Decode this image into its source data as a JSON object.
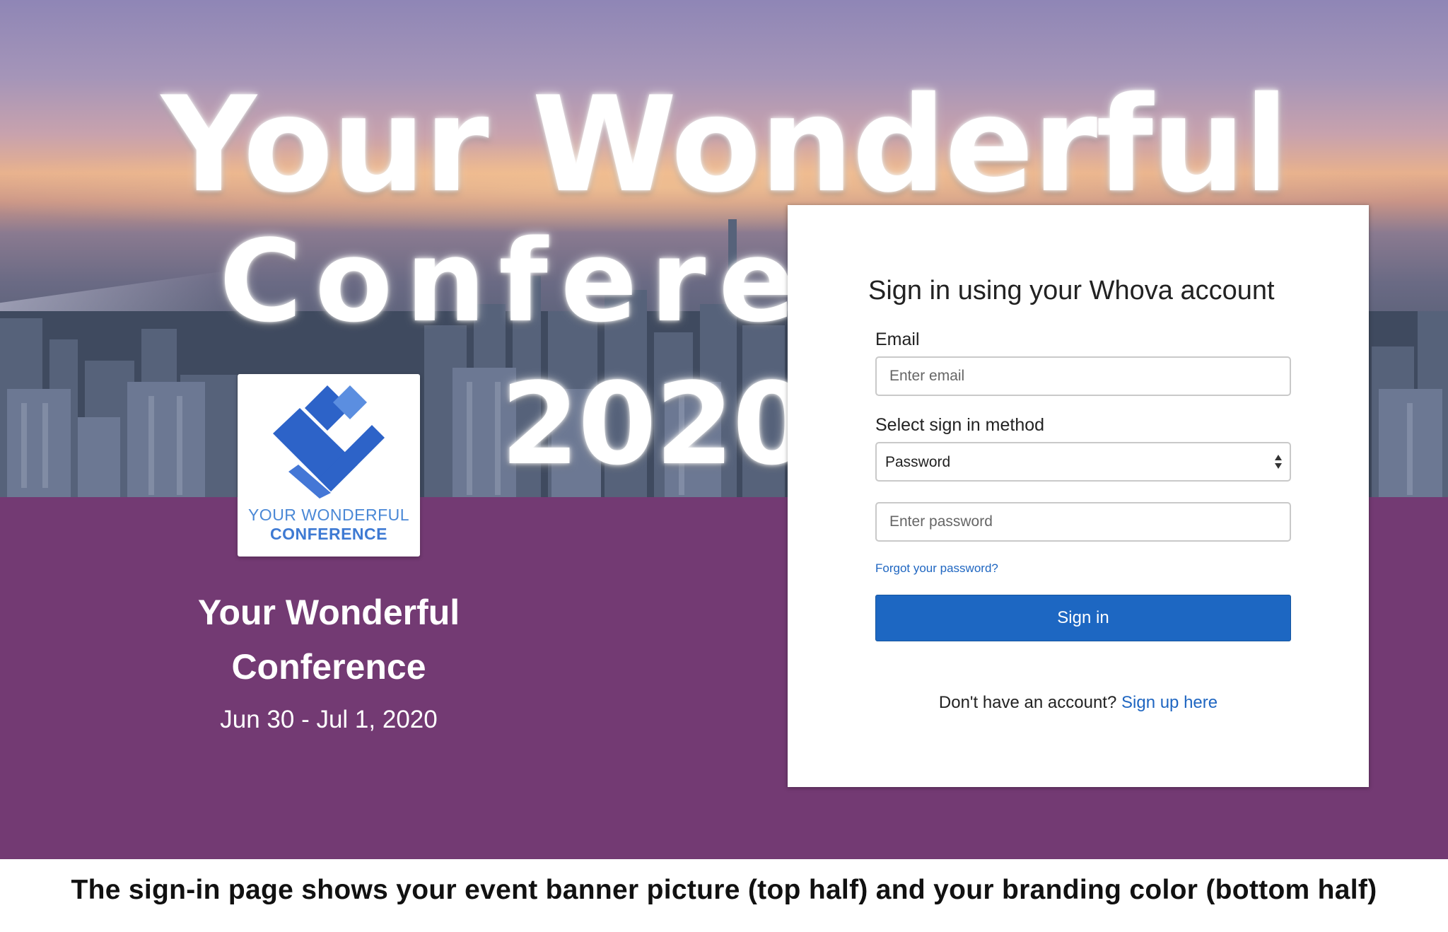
{
  "banner": {
    "line1": "Your Wonderful",
    "line2": "Confere",
    "line3": "2020"
  },
  "logo": {
    "line1": "YOUR WONDERFUL",
    "line2": "CONFERENCE",
    "color": "#3e7ad3"
  },
  "event": {
    "name": "Your Wonderful Conference",
    "dates": "Jun 30 - Jul 1, 2020"
  },
  "signin": {
    "title": "Sign in using your Whova account",
    "email_label": "Email",
    "email_placeholder": "Enter email",
    "method_label": "Select sign in method",
    "method_value": "Password",
    "password_placeholder": "Enter password",
    "forgot_link": "Forgot your password?",
    "submit_label": "Sign in",
    "signup_prompt": "Don't have an account?",
    "signup_link": "Sign up here"
  },
  "caption": "The sign-in page shows your event banner picture (top half) and your branding color (bottom half)",
  "colors": {
    "branding": "#733a73",
    "primary_button": "#1d67c2",
    "link": "#1f66c1"
  }
}
